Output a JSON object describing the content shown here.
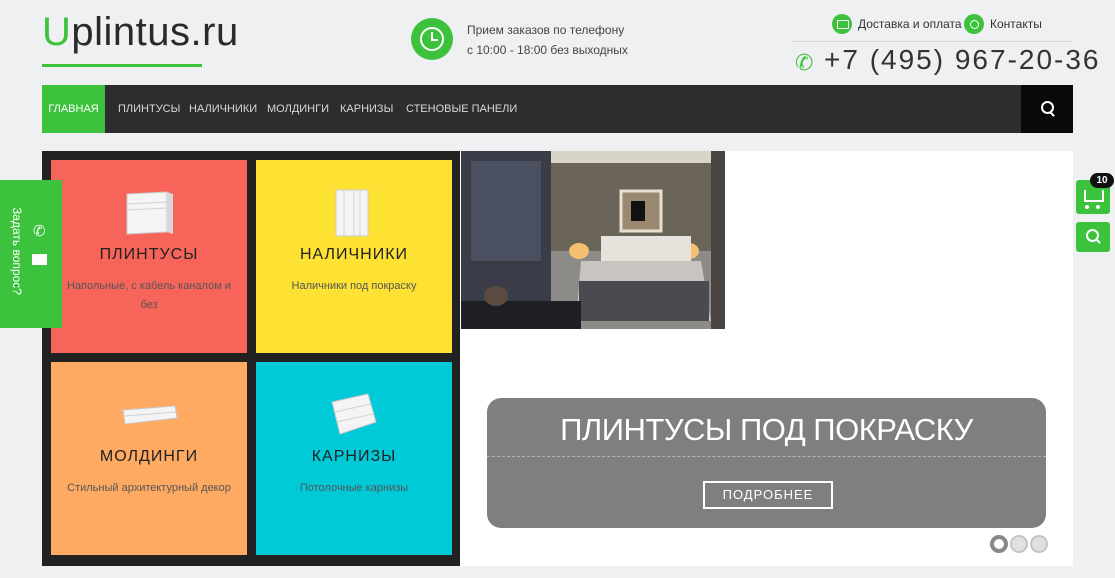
{
  "header": {
    "logo_first_letter": "U",
    "logo_rest": "plintus.ru",
    "order_hours_line1": "Прием заказов по телефону",
    "order_hours_line2": "с 10:00 - 18:00 без выходных",
    "delivery_link": "Доставка и оплата",
    "contacts_link": "Контакты",
    "phone": "+7 (495) 967-20-36"
  },
  "nav": {
    "items": [
      "ГЛАВНАЯ",
      "ПЛИНТУСЫ",
      "НАЛИЧНИКИ",
      "МОЛДИНГИ",
      "КАРНИЗЫ",
      "СТЕНОВЫЕ ПАНЕЛИ"
    ],
    "active_index": 0
  },
  "tiles": [
    {
      "title": "ПЛИНТУСЫ",
      "desc": "Напольные, с кабель каналом и без",
      "color": "#f7655a"
    },
    {
      "title": "НАЛИЧНИКИ",
      "desc": "Наличники под покраску",
      "color": "#fde234"
    },
    {
      "title": "МОЛДИНГИ",
      "desc": "Стильный архитектурный декор",
      "color": "#ffaa63"
    },
    {
      "title": "КАРНИЗЫ",
      "desc": "Потолочные карнизы",
      "color": "#00cad8"
    }
  ],
  "slider": {
    "caption": "ПЛИНТУСЫ ПОД ПОКРАСКУ",
    "button": "ПОДРОБНЕЕ",
    "slides": 3,
    "active_slide": 0
  },
  "side": {
    "ask_label": "Задать вопрос?",
    "cart_count": "10"
  },
  "colors": {
    "accent": "#3cc23c",
    "nav_bg": "#2d2d2d"
  }
}
